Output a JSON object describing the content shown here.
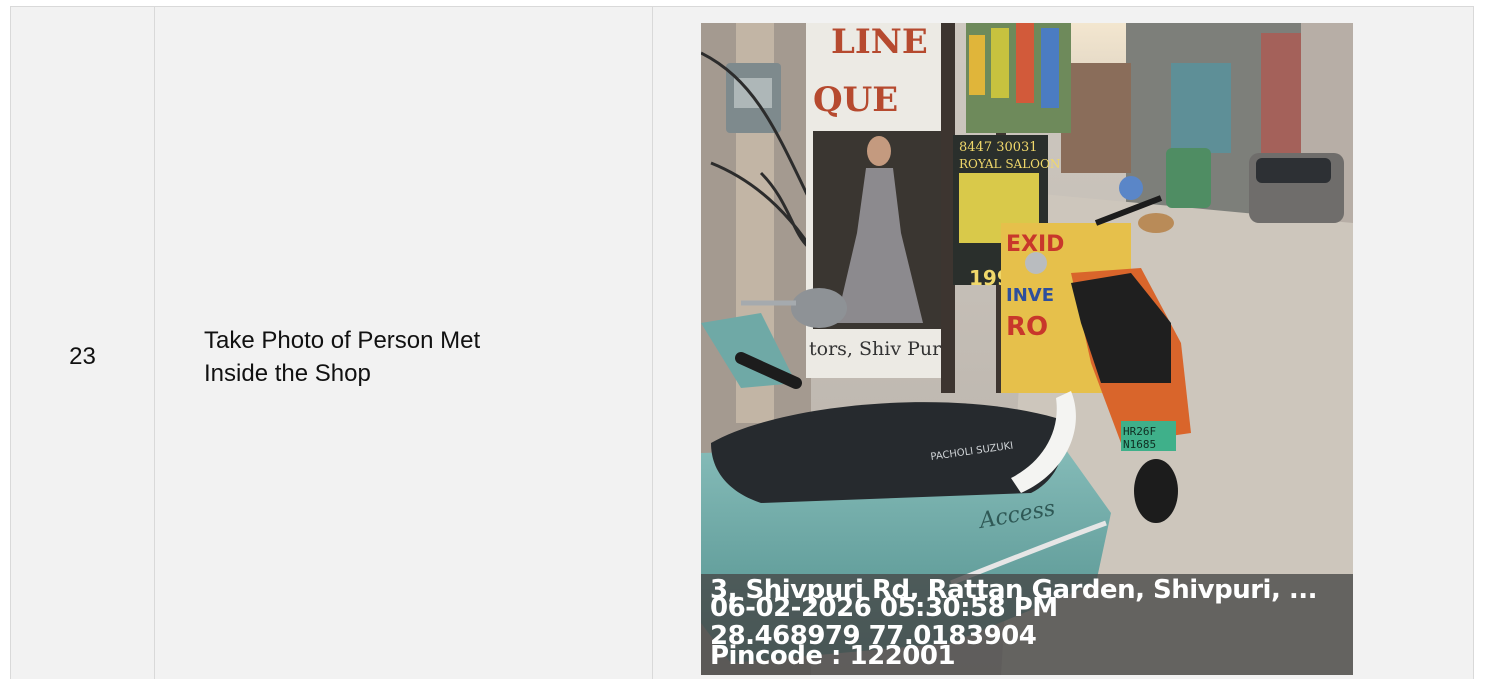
{
  "row": {
    "index": "23",
    "label_line1": "Take Photo of Person Met",
    "label_line2": "Inside the Shop"
  },
  "photo": {
    "subject": "street-scene-with-parked-scooters",
    "sign_lines": [
      "LINE",
      "QUE"
    ],
    "sign_caption": "tors, Shiv Puri",
    "billboard_phone": "8447 30031",
    "billboard_name": "ROYAL SALOON",
    "billboard_price": "199",
    "poster_text": "EXID",
    "poster_sub": "INVE",
    "poster_ro": "RO",
    "plate_line1": "HR26F",
    "plate_line2": "N1685",
    "scooter_badge": "Access",
    "seat_text": "PACHOLI SUZUKI",
    "overlay": {
      "address": "3, Shivpuri Rd, Rattan Garden, Shivpuri, ...",
      "datetime": "06-02-2026 05:30:58 PM",
      "coords": "28.468979 77.0183904",
      "pincode": "Pincode : 122001"
    }
  },
  "colors": {
    "cell_bg": "#f2f2f2",
    "cell_border": "#d9d9d9",
    "scooter_teal": "#6fa9a6",
    "scooter_orange": "#d9652b",
    "plate_green": "#3fb08a",
    "overlay_bg": "#464646"
  }
}
